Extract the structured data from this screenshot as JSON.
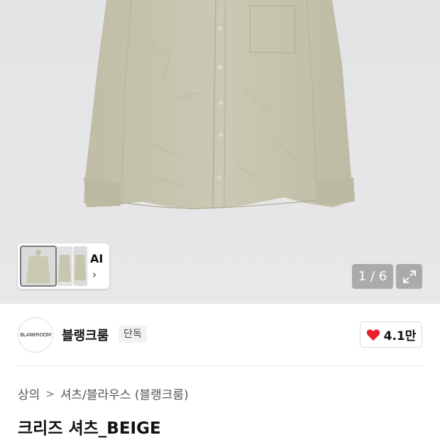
{
  "gallery": {
    "counter": "1 / 6",
    "ai_label": "AI",
    "ai_chevron": "›",
    "shirt_color": "#c9c7b1"
  },
  "brand": {
    "logo_text": "BLANKROOM",
    "name": "블랭크룸",
    "badge": "단독",
    "like_count": "4.1만",
    "like_color": "#e8202a"
  },
  "breadcrumb": {
    "items": [
      "상의",
      "셔츠/블라우스 (블랭크룸)"
    ],
    "separator": ">"
  },
  "product": {
    "title": "크리즈 셔츠_BEIGE"
  }
}
